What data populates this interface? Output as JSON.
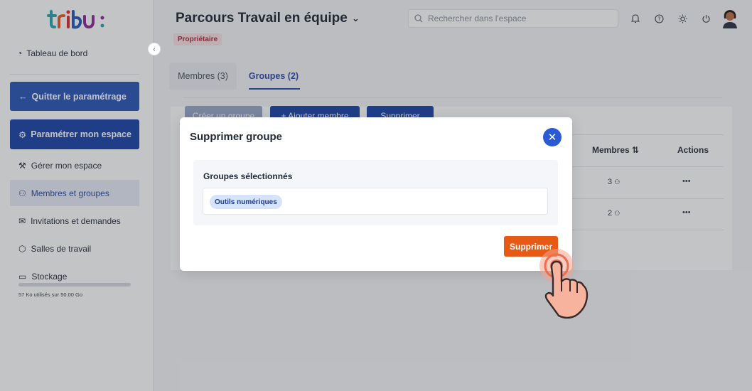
{
  "app": {
    "logo_text": "tribu:"
  },
  "sidebar": {
    "dashboard": "Tableau de bord",
    "quit": "Quitter le paramétrage",
    "configure": "Paramétrer mon espace",
    "items": [
      {
        "label": "Gérer mon espace",
        "icon": "wrench-icon"
      },
      {
        "label": "Membres et groupes",
        "icon": "users-icon",
        "active": true
      },
      {
        "label": "Invitations et demandes",
        "icon": "mail-icon"
      },
      {
        "label": "Salles de travail",
        "icon": "cube-icon"
      },
      {
        "label": "Stockage",
        "icon": "folder-icon"
      }
    ],
    "storage_text": "57 Ko utilisés sur 50.00 Go"
  },
  "header": {
    "title": "Parcours Travail en équipe",
    "badge": "Propriétaire",
    "search_placeholder": "Rechercher dans l'espace"
  },
  "tabs": [
    {
      "label": "Membres (3)"
    },
    {
      "label": "Groupes (2)",
      "active": true
    }
  ],
  "toolbar": {
    "create_group": "Créer un groupe",
    "add_member": "+ Ajouter membre",
    "delete": "Supprimer"
  },
  "table": {
    "col_members": "Membres ⇅",
    "col_actions": "Actions",
    "rows": [
      {
        "members": "3",
        "actions": "•••"
      },
      {
        "members": "2",
        "actions": "•••"
      }
    ]
  },
  "modal": {
    "title": "Supprimer groupe",
    "section_label": "Groupes sélectionnés",
    "selected": [
      "Outils numériques"
    ],
    "confirm": "Supprimer"
  },
  "colors": {
    "primary": "#2b56b6",
    "danger": "#e65a16",
    "badge": "#b5283a"
  }
}
